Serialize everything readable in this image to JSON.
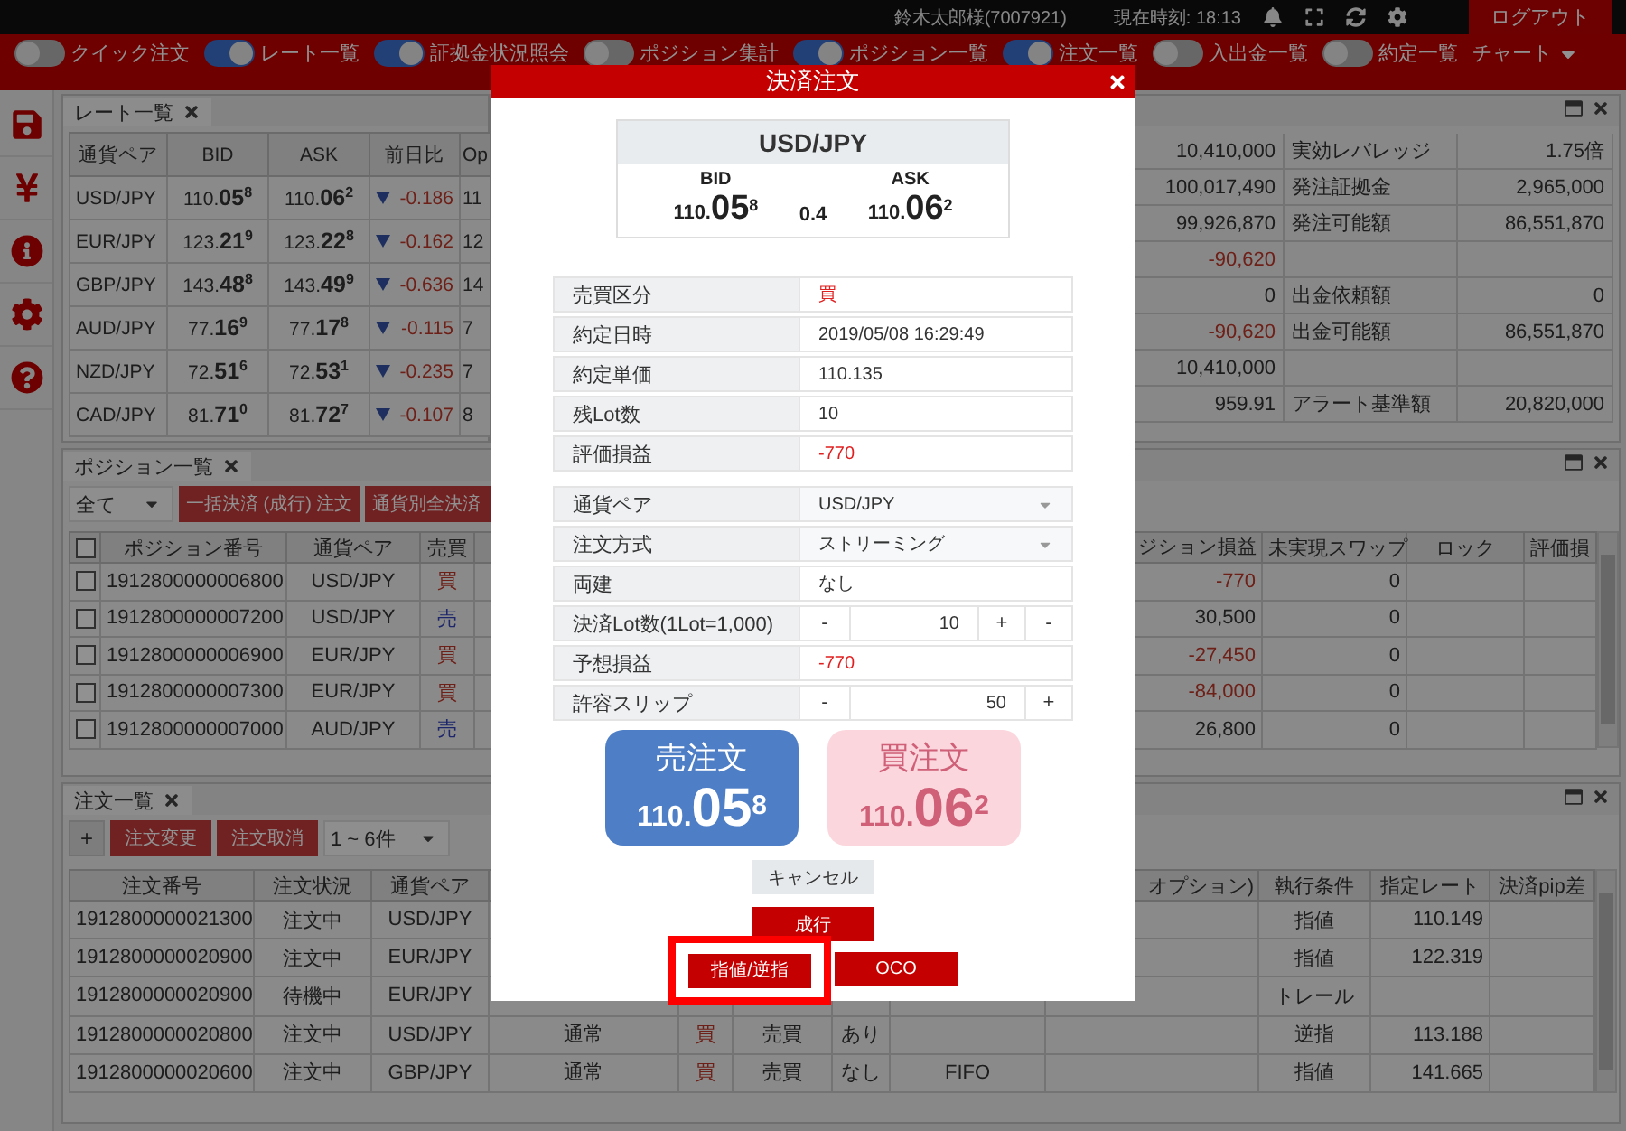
{
  "top_bar": {
    "user": "鈴木太郎様(7007921)",
    "clock": "現在時刻: 18:13",
    "logout": "ログアウト"
  },
  "toolbar": {
    "toggles": [
      {
        "label": "クイック注文",
        "on": false
      },
      {
        "label": "レート一覧",
        "on": true
      },
      {
        "label": "証拠金状況照会",
        "on": true
      },
      {
        "label": "ポジション集計",
        "on": false
      },
      {
        "label": "ポジション一覧",
        "on": true
      },
      {
        "label": "注文一覧",
        "on": true
      },
      {
        "label": "入出金一覧",
        "on": false
      },
      {
        "label": "約定一覧",
        "on": false
      }
    ],
    "chart_menu": "チャート"
  },
  "rate_panel": {
    "tab": "レート一覧",
    "columns": [
      "通貨ペア",
      "BID",
      "ASK",
      "前日比",
      "Op"
    ],
    "rows": [
      {
        "pair": "USD/JPY",
        "bid": "110.**05**$^{8}$",
        "ask": "110.**06**$^{2}$",
        "falling": true,
        "change": "-0.186",
        "open": "11"
      },
      {
        "pair": "EUR/JPY",
        "bid": "123.**21**$^{9}$",
        "ask": "123.**22**$^{8}$",
        "falling": true,
        "change": "-0.162",
        "open": "12"
      },
      {
        "pair": "GBP/JPY",
        "bid": "143.**48**$^{8}$",
        "ask": "143.**49**$^{9}$",
        "falling": true,
        "change": "-0.636",
        "open": "14"
      },
      {
        "pair": "AUD/JPY",
        "bid": "77.**16**$^{9}$",
        "ask": "77.**17**$^{8}$",
        "falling": true,
        "change": "-0.115",
        "open": "7"
      },
      {
        "pair": "NZD/JPY",
        "bid": "72.**51**$^{6}$",
        "ask": "72.**53**$^{1}$",
        "falling": true,
        "change": "-0.235",
        "open": "7"
      },
      {
        "pair": "CAD/JPY",
        "bid": "81.**71**$^{0}$",
        "ask": "81.**72**$^{7}$",
        "falling": true,
        "change": "-0.107",
        "open": "8"
      }
    ]
  },
  "margin_panel": {
    "rows": [
      {
        "amount": "10,410,000",
        "negative": false,
        "item": {
          "label": "実効レバレッジ",
          "value": "1.75倍"
        }
      },
      {
        "amount": "100,017,490",
        "negative": false,
        "item": {
          "label": "発注証拠金",
          "value": "2,965,000"
        }
      },
      {
        "amount": "99,926,870",
        "negative": false,
        "item": {
          "label": "発注可能額",
          "value": "86,551,870"
        }
      },
      {
        "amount": "-90,620",
        "negative": true
      },
      {
        "amount": "0",
        "negative": false,
        "item": {
          "label": "出金依頼額",
          "value": "0"
        }
      },
      {
        "amount": "-90,620",
        "negative": true,
        "item": {
          "label": "出金可能額",
          "value": "86,551,870"
        }
      },
      {
        "amount": "10,410,000",
        "negative": false
      },
      {
        "amount": "959.91",
        "negative": false,
        "item": {
          "label": "アラート基準額",
          "value": "20,820,000"
        }
      }
    ]
  },
  "positions": {
    "tab": "ポジション一覧",
    "filter": "全て",
    "buttons": [
      "一括決済 (成行) 注文",
      "通貨別全決済"
    ],
    "select_all_checked": false,
    "columns": [
      "ポジション番号",
      "通貨ペア",
      "売買",
      "ジション損益",
      "未実現スワップ",
      "ロック",
      "評価損"
    ],
    "rows": [
      {
        "checked": false,
        "id": "1912800000006800",
        "pair": "USD/JPY",
        "buy": true,
        "side_label": "買",
        "pl": "-770",
        "pl_negative": true,
        "swap": "0"
      },
      {
        "checked": false,
        "id": "1912800000007200",
        "pair": "USD/JPY",
        "buy": false,
        "side_label": "売",
        "pl": "30,500",
        "pl_negative": false,
        "swap": "0"
      },
      {
        "checked": false,
        "id": "1912800000006900",
        "pair": "EUR/JPY",
        "buy": true,
        "side_label": "買",
        "pl": "-27,450",
        "pl_negative": true,
        "swap": "0"
      },
      {
        "checked": false,
        "id": "1912800000007300",
        "pair": "EUR/JPY",
        "buy": true,
        "side_label": "買",
        "pl": "-84,000",
        "pl_negative": true,
        "swap": "0"
      },
      {
        "checked": false,
        "id": "1912800000007000",
        "pair": "AUD/JPY",
        "buy": false,
        "side_label": "売",
        "pl": "26,800",
        "pl_negative": false,
        "swap": "0"
      }
    ]
  },
  "orders": {
    "tab": "注文一覧",
    "add": "+",
    "buttons": [
      "注文変更",
      "注文取消"
    ],
    "range": "1 ~ 6件",
    "columns": [
      "注文番号",
      "注文状況",
      "通貨ペア",
      null,
      null,
      null,
      null,
      null,
      "オプション)",
      "執行条件",
      "指定レート",
      "決済pip差"
    ],
    "rows": [
      {
        "cells": [
          "1912800000021300",
          "注文中",
          "USD/JPY",
          null,
          null,
          null,
          null,
          null,
          null,
          "指値",
          "110.149",
          null
        ]
      },
      {
        "cells": [
          "1912800000020900",
          "注文中",
          "EUR/JPY",
          null,
          null,
          null,
          null,
          null,
          null,
          "指値",
          "122.319",
          null
        ]
      },
      {
        "cells": [
          "1912800000020900",
          "待機中",
          "EUR/JPY",
          null,
          null,
          null,
          null,
          null,
          null,
          "トレール",
          null,
          null
        ]
      },
      {
        "buy": true,
        "cells": [
          "1912800000020800",
          "注文中",
          "USD/JPY",
          "通常",
          "買",
          "売買",
          "あり",
          null,
          null,
          "逆指",
          "113.188",
          null
        ]
      },
      {
        "buy": true,
        "cells": [
          "1912800000020600",
          "注文中",
          "GBP/JPY",
          "通常",
          "買",
          "売買",
          "なし",
          "FIFO",
          null,
          "指値",
          "141.665",
          null
        ]
      }
    ]
  },
  "dialog": {
    "title": "決済注文",
    "quote": {
      "pair": "USD/JPY",
      "bid_label": "BID",
      "ask_label": "ASK",
      "bid": "110.**05**$^{8}$",
      "spread": "0.4",
      "ask": "110.**06**$^{2}$"
    },
    "details": [
      {
        "label": "売買区分",
        "value": "買",
        "highlight": true
      },
      {
        "label": "約定日時",
        "value": "2019/05/08 16:29:49",
        "highlight": false
      },
      {
        "label": "約定単価",
        "value": "110.135",
        "highlight": false
      },
      {
        "label": "残Lot数",
        "value": "10",
        "highlight": false
      },
      {
        "label": "評価損益",
        "value": "-770",
        "highlight": true
      }
    ],
    "form": [
      {
        "kind": "select",
        "label": "通貨ペア",
        "value": "USD/JPY"
      },
      {
        "kind": "select",
        "label": "注文方式",
        "value": "ストリーミング"
      },
      {
        "kind": "text",
        "label": "両建",
        "value": "なし",
        "highlight": false
      },
      {
        "kind": "stepper",
        "label": "決済Lot数(1Lot=1,000)",
        "value": "10",
        "decrement": "-",
        "increment": "+",
        "extra": "-"
      },
      {
        "kind": "text",
        "label": "予想損益",
        "value": "-770",
        "highlight": true
      },
      {
        "kind": "stepper",
        "label": "許容スリップ",
        "value": "50",
        "decrement": "-",
        "increment": "+"
      }
    ],
    "order_buttons": [
      {
        "buy": false,
        "label": "売注文",
        "price": "110.**05**$^{8}$",
        "disabled": false
      },
      {
        "buy": true,
        "label": "買注文",
        "price": "110.**06**$^{2}$",
        "disabled": true
      }
    ],
    "actions": [
      [
        {
          "kind": "cancel",
          "label": "キャンセル",
          "highlighted": false
        }
      ],
      [
        {
          "kind": "market",
          "label": "成行",
          "highlighted": false
        }
      ],
      [
        {
          "kind": "limit",
          "label": "指値/逆指",
          "highlighted": true
        },
        {
          "kind": "oco",
          "label": "OCO",
          "highlighted": false
        }
      ]
    ]
  }
}
